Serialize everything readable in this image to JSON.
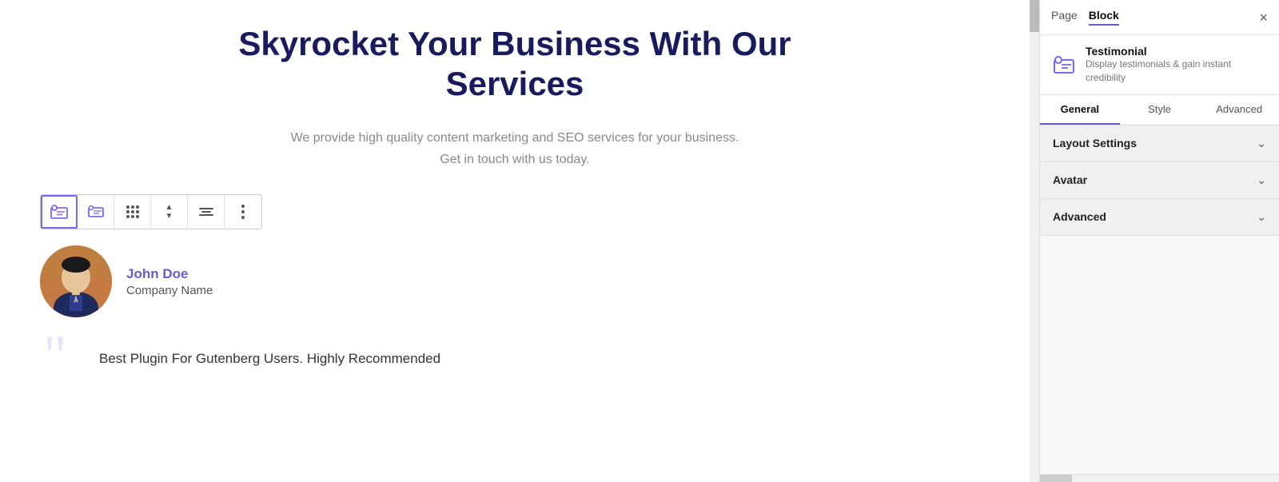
{
  "header": {
    "title": "Skyrocket Your Business With Our Services",
    "subtitle_line1": "We provide high quality content marketing and SEO services for your business.",
    "subtitle_line2": "Get in touch with us today."
  },
  "testimonial": {
    "author_name": "John Doe",
    "author_company": "Company Name",
    "quote": "Best Plugin For Gutenberg Users. Highly Recommended"
  },
  "toolbar": {
    "buttons": [
      "testimonial-icon",
      "block-icon",
      "drag-icon",
      "move-icon",
      "align-icon",
      "more-icon"
    ]
  },
  "sidebar": {
    "tabs": [
      "Page",
      "Block"
    ],
    "active_tab": "Block",
    "close_label": "×",
    "block_title": "Testimonial",
    "block_description": "Display testimonials & gain instant credibility",
    "inner_tabs": [
      "General",
      "Style",
      "Advanced"
    ],
    "active_inner_tab": "General",
    "accordion_sections": [
      {
        "label": "Layout Settings",
        "expanded": false
      },
      {
        "label": "Avatar",
        "expanded": false
      },
      {
        "label": "Advanced",
        "expanded": false
      }
    ]
  }
}
